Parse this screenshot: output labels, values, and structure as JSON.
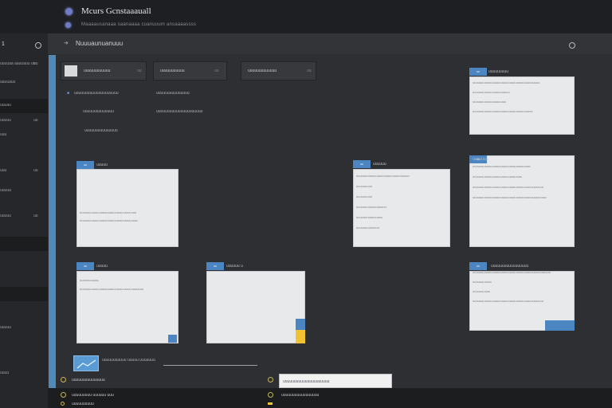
{
  "app": {
    "title": "Mcurs Gcnstaaauall",
    "subtitle": "Maaaausanaaa saanaaaa cuanuuum ansaaaassss"
  },
  "header": {
    "breadcrumb": "Nuuuaunuanuuu",
    "left_mark": "1"
  },
  "sidebar": {
    "items": [
      {
        "label": "uuuuaa aauuauu uu",
        "right": "nu"
      },
      {
        "label": "aauuauu",
        "right": ""
      },
      {
        "label": "uuuau",
        "right": ""
      },
      {
        "label": "uuuuu",
        "right": "uu"
      },
      {
        "label": "uuu",
        "right": ""
      },
      {
        "label": "uuu",
        "right": "uu"
      },
      {
        "label": "uuuua",
        "right": ""
      },
      {
        "label": "uuuuu",
        "right": "uu"
      },
      {
        "label": "uuuuu",
        "right": ""
      },
      {
        "label": "uuuu",
        "right": ""
      }
    ]
  },
  "toolbar": {
    "tabs": [
      {
        "label": "uuuuuuuuuuuu",
        "extra": "uu"
      },
      {
        "label": "uuuuuuuuuuu",
        "extra": "uu"
      },
      {
        "label": "uuuuuuuuuuuuu",
        "extra": "uu"
      }
    ]
  },
  "filters": {
    "row1_left": "uuuuuuuuuuuuuuuuuuuu",
    "row1_right": "uuuuuuuuuuuuuuu",
    "row2_left": "uuuuuuuuuuuuuu",
    "row2_right": "uuuuuuuuuuuuuuuuuuuuu",
    "row3_left": "uuuuuuuuuuuuuuu"
  },
  "cards": [
    {
      "tag": "uu",
      "head": "uuuuu",
      "lines": [
        "uuuuuuuuuuuuuuuuuuuuuuuuuuuuuuuu",
        "uuuuuuuuuuuuuuuuuuuuuuuuuuuuuuuuu"
      ]
    },
    {
      "tag": "uu",
      "head": "uuuuuu",
      "lines": [
        "uuuuuuuuuuuuuuuuuuuuuuuuuuuuuu",
        "uuuuuuuuu",
        "uuuuuuuuu",
        "uuuuuuuuuuuuuuuuu",
        "uuuuuuuuuuuuuuu",
        "uuuuuuuuuuuuu"
      ]
    },
    {
      "tag": "uu",
      "head": "uuuuuuuuu",
      "lines": [
        "uuuuuuuuuuuuuuuuuuuuuuuuuuuuuuuuuuuuuu",
        "uuuuuuuuuuuuuuuuuuuuu",
        "uuuuuuuuuuuuuuuuuuu",
        "uuuuuuuuuuuuuuuuuuuuuuuuuuuuuuuuuu"
      ]
    },
    {
      "tag": "uu",
      "head": "uuuuuuu",
      "lines": [
        "uuuuuuuuuuuuuuuuuuuuuuuuuuuuuuuuu",
        "uuuuuuuuuuuuuuuuuuuuuuuuuuuu",
        "uuuuuuuuuuuuuuuuuuuuuuuuuuuuuuuuuuuuuuuu",
        "uuuuuuuuuuuuuuuuuuuuuuuuuuuuuuuuuuuuuuuuuu"
      ]
    },
    {
      "tag": "uu",
      "head": "uuuuuu u",
      "lines": []
    },
    {
      "tag": "uu",
      "head": "uuuuu",
      "lines": [
        "uuuuuuuuuuu",
        "uuuuuuuuuuuuuuuuuuuuuuuuuuuuuuuuuuuu"
      ]
    },
    {
      "tag": "uu",
      "head": "uuuuuuuuuuuuuuuuu",
      "lines": [
        "uuuuuuuuuuuuuuuuuuuuuuuuuuuuuuuuuuuuuuuuuuuu",
        "uuuuuuuuuuu",
        "uuuuuuuuuu",
        "uuuuuuuuuuuuuuuuuuuuuuuuuuuuuuuuuuuuuuuu"
      ]
    }
  ],
  "footer": {
    "thumb_caption": "uuuuuuuuuuu uuuuu uuuuuuu",
    "left_row1": "uuuuuuuuuuuuuuu",
    "left_row2": "uuuuuuuuu uuuuuu uuu",
    "left_row3": "uuuuuuuuuu",
    "status_value": "uuuuuuuuuuuuuuuuuuuuu",
    "status_row2": "uuuuuuuuuuuuuuuuu"
  },
  "colors": {
    "accent": "#4b86c3",
    "highlight": "#f2c232",
    "background": "#2b2c2f"
  }
}
